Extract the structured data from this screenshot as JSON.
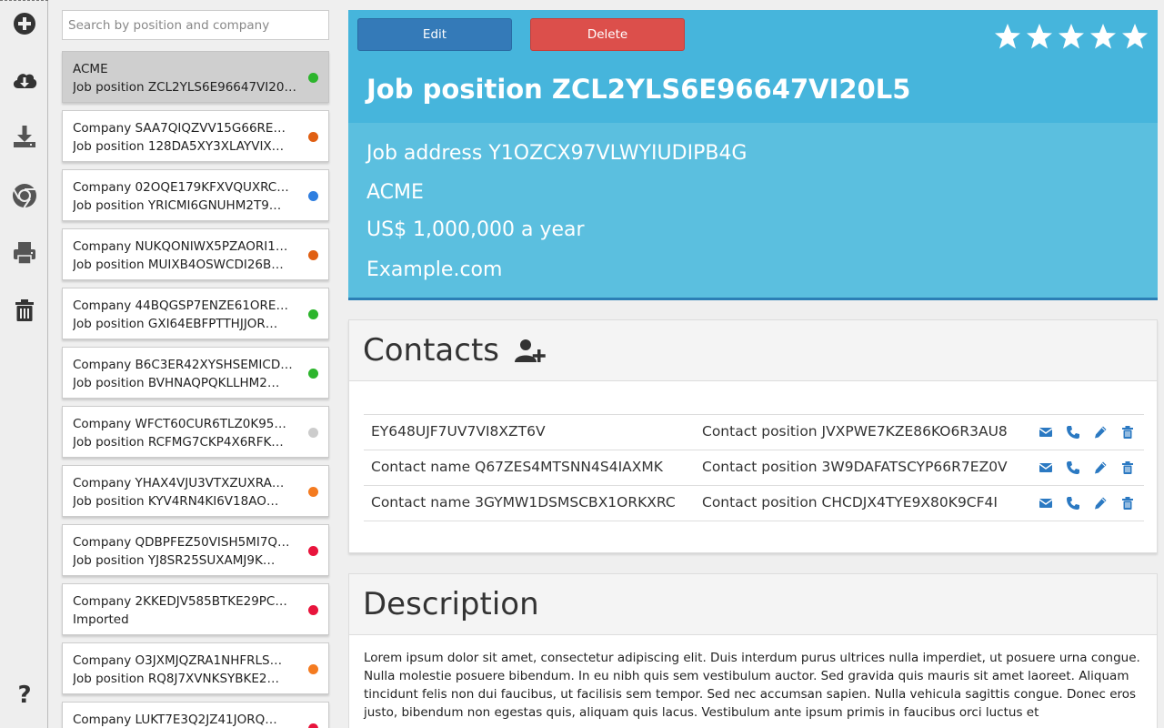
{
  "search": {
    "placeholder": "Search by position and company"
  },
  "toolbar": {
    "icons": [
      "plus-circle-icon",
      "cloud-download-icon",
      "download-icon",
      "chrome-icon",
      "print-icon",
      "trash-icon",
      "question-icon"
    ]
  },
  "list": {
    "items": [
      {
        "company": "ACME",
        "position": "Job position ZCL2YLS6E96647VI20L5",
        "status_color": "#2db52d",
        "selected": true
      },
      {
        "company": "Company SAA7QIQZVV15G66RE…",
        "position": "Job position 128DA5XY3XLAYVIX…",
        "status_color": "#e05f12"
      },
      {
        "company": "Company 02OQE179KFXVQUXRC…",
        "position": "Job position YRICMI6GNUHM2T9…",
        "status_color": "#2f7fe0"
      },
      {
        "company": "Company NUKQONIWX5PZAORI1…",
        "position": "Job position MUIXB4OSWCDI26B…",
        "status_color": "#e05f12"
      },
      {
        "company": "Company 44BQGSP7ENZE61ORE…",
        "position": "Job position GXI64EBFPTTHJJOR…",
        "status_color": "#2db52d"
      },
      {
        "company": "Company B6C3ER42XYSHSEMICD…",
        "position": "Job position BVHNAQPQKLLHM2…",
        "status_color": "#2db52d"
      },
      {
        "company": "Company WFCT60CUR6TLZ0K95…",
        "position": "Job position RCFMG7CKP4X6RFK…",
        "status_color": "#cccccc"
      },
      {
        "company": "Company YHAX4VJU3VTXZUXRA…",
        "position": "Job position KYV4RN4KI6V18AO…",
        "status_color": "#f47b20"
      },
      {
        "company": "Company QDBPFEZ50VISH5MI7Q…",
        "position": "Job position YJ8SR25SUXAMJ9K…",
        "status_color": "#e8143c"
      },
      {
        "company": "Company 2KKEDJV585BTKE29PC…",
        "position": "Imported",
        "status_color": "#e8143c"
      },
      {
        "company": "Company O3JXMJQZRA1NHFRLS…",
        "position": "Job position RQ8J7XVNKSYBKE2…",
        "status_color": "#f47b20"
      },
      {
        "company": "Company LUKT7E3Q2JZ41JORQ…",
        "position": "",
        "status_color": "#e8143c"
      }
    ]
  },
  "header": {
    "edit_label": "Edit",
    "delete_label": "Delete",
    "rating": 5,
    "title": "Job position ZCL2YLS6E96647VI20L5",
    "address": "Job address Y1OZCX97VLWYIUDIPB4G",
    "company": "ACME",
    "salary": "US$ 1,000,000 a year",
    "website": "Example.com"
  },
  "contacts": {
    "heading": "Contacts",
    "rows": [
      {
        "name": "EY648UJF7UV7VI8XZT6V",
        "position": "Contact position JVXPWE7KZE86KO6R3AU8"
      },
      {
        "name": "Contact name Q67ZES4MTSNN4S4IAXMK",
        "position": "Contact position 3W9DAFATSCYP66R7EZ0V"
      },
      {
        "name": "Contact name 3GYMW1DSMSCBX1ORKXRC",
        "position": "Contact position CHCDJX4TYE9X80K9CF4I"
      }
    ]
  },
  "description": {
    "heading": "Description",
    "text": "Lorem ipsum dolor sit amet, consectetur adipiscing elit. Duis interdum purus ultrices nulla imperdiet, ut posuere urna congue. Nulla molestie posuere bibendum. In eu nibh quis sem vestibulum auctor. Sed gravida quis mauris sit amet laoreet. Aliquam tincidunt felis non dui faucibus, ut facilisis sem tempor. Sed nec accumsan sapien. Nulla vehicula sagittis congue. Donec eros justo, bibendum non egestas quis, aliquam quis lacus. Vestibulum ante ipsum primis in faucibus orci luctus et"
  },
  "colors": {
    "header_bg": "#5bbfdf",
    "header_top_bg": "#46b5dc",
    "edit_button": "#347ab8",
    "delete_button": "#dc4f4b",
    "action_icon": "#2b79c2"
  }
}
